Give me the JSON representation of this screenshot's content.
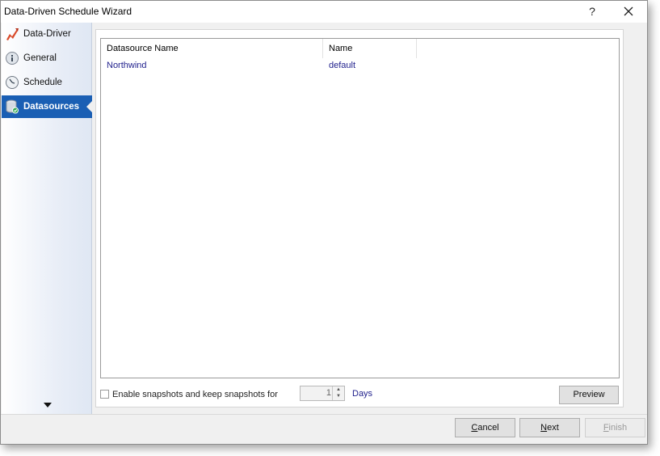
{
  "window": {
    "title": "Data-Driven Schedule Wizard",
    "help_label": "?",
    "accent_color": "#1a5fb4"
  },
  "sidebar": {
    "items": [
      {
        "label": "Data-Driver",
        "icon": "data-driver-icon",
        "active": false
      },
      {
        "label": "General",
        "icon": "info-icon",
        "active": false
      },
      {
        "label": "Schedule",
        "icon": "clock-icon",
        "active": false
      },
      {
        "label": "Datasources",
        "icon": "database-icon",
        "active": true
      }
    ]
  },
  "grid": {
    "columns": [
      "Datasource Name",
      "Name"
    ],
    "rows": [
      {
        "datasource_name": "Northwind",
        "name": "default"
      }
    ]
  },
  "snapshots": {
    "checkbox_label": "Enable snapshots and keep snapshots for",
    "checked": false,
    "days_value": "1",
    "days_label": "Days",
    "preview_label": "Preview"
  },
  "footer": {
    "cancel_prefix": "",
    "cancel_ul": "C",
    "cancel_rest": "ancel",
    "next_prefix": "",
    "next_ul": "N",
    "next_rest": "ext",
    "finish_prefix": "",
    "finish_ul": "F",
    "finish_rest": "inish"
  }
}
